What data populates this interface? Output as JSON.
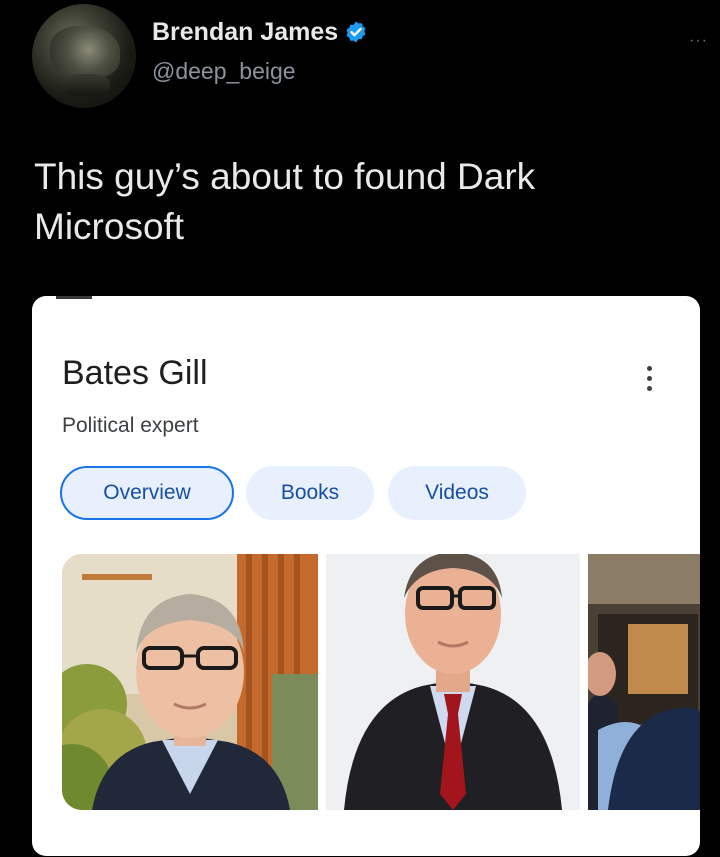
{
  "tweet": {
    "author_name": "Brendan James",
    "handle": "@deep_beige",
    "more_label": "···",
    "text": "This guy’s about to found Dark Microsoft"
  },
  "embed": {
    "title": "Bates Gill",
    "subtitle": "Political expert",
    "tabs": [
      {
        "label": "Overview",
        "selected": true
      },
      {
        "label": "Books",
        "selected": false
      },
      {
        "label": "Videos",
        "selected": false
      }
    ],
    "photos": [
      {
        "description_icon": "person-photo"
      },
      {
        "description_icon": "person-photo"
      },
      {
        "description_icon": "person-photo"
      }
    ]
  },
  "colors": {
    "background": "#000000",
    "verified_blue": "#1d9bf0",
    "chip_border": "#1a73e8",
    "chip_bg": "#e8f0fe",
    "chip_text": "#174ea6"
  }
}
